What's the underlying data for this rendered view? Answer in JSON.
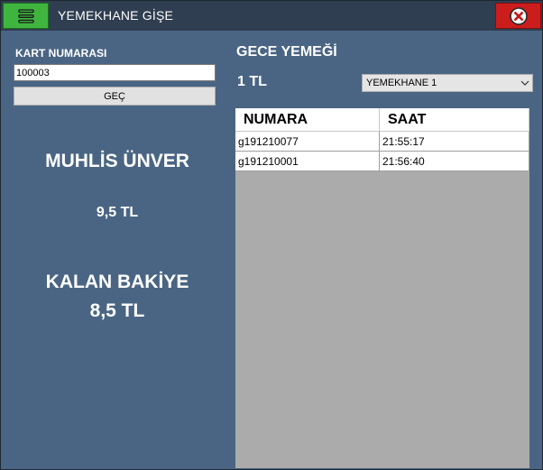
{
  "window": {
    "title": "YEMEKHANE GİŞE",
    "menu_icon": "hamburger-icon",
    "close_icon": "close-circle-icon",
    "colors": {
      "menu_button": "#3fb53f",
      "close_button": "#cc1d1d",
      "background": "#4a6584",
      "titlebar": "#2f3e50"
    }
  },
  "left": {
    "card_label": "KART NUMARASI",
    "card_value": "100003",
    "go_label": "GEÇ",
    "person_name": "MUHLİS ÜNVER",
    "price": "9,5 TL",
    "balance_label": "KALAN BAKİYE",
    "balance_value": "8,5 TL"
  },
  "right": {
    "meal_title": "GECE YEMEĞİ",
    "meal_price": "1 TL",
    "cafeteria_selected": "YEMEKHANE 1",
    "table": {
      "headers": [
        "NUMARA",
        "SAAT"
      ],
      "rows": [
        [
          "g191210077",
          "21:55:17"
        ],
        [
          "g191210001",
          "21:56:40"
        ]
      ]
    }
  }
}
